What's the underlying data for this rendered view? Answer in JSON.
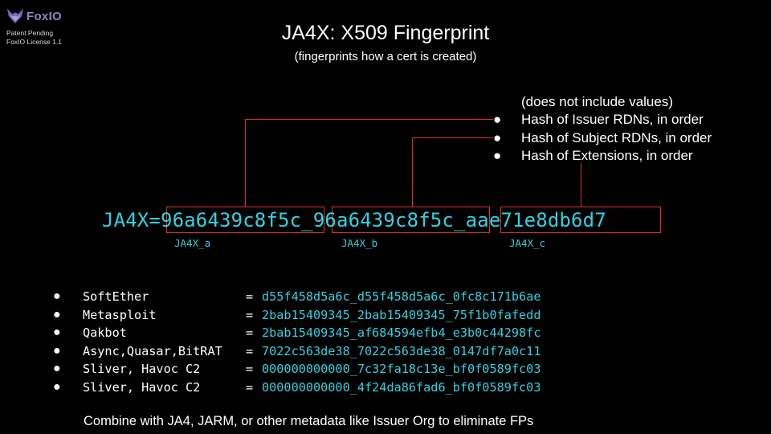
{
  "logo": {
    "text": "FoxIO",
    "brand_color": "#8e86c2"
  },
  "patent": {
    "line1": "Patent Pending",
    "line2": "FoxIO License 1.1"
  },
  "title": "JA4X: X509 Fingerprint",
  "subtitle": "(fingerprints how a cert is created)",
  "description": {
    "note": "(does not include values)",
    "items": [
      "Hash of Issuer RDNs, in order",
      "Hash of Subject RDNs, in order",
      "Hash of Extensions, in order"
    ]
  },
  "fingerprint": {
    "prefix": "JA4X=",
    "part_a": "96a6439c8f5c",
    "sep1": "_",
    "part_b": "96a6439c8f5c",
    "sep2": "_",
    "part_c": "aae71e8db6d7",
    "label_a": "JA4X_a",
    "label_b": "JA4X_b",
    "label_c": "JA4X_c"
  },
  "examples": [
    {
      "name": "SoftEther",
      "value": "d55f458d5a6c_d55f458d5a6c_0fc8c171b6ae"
    },
    {
      "name": "Metasploit",
      "value": "2bab15409345_2bab15409345_75f1b0fafedd"
    },
    {
      "name": "Qakbot",
      "value": "2bab15409345_af684594efb4_e3b0c44298fc"
    },
    {
      "name": "Async,Quasar,BitRAT",
      "value": "7022c563de38_7022c563de38_0147df7a0c11"
    },
    {
      "name": "Sliver, Havoc C2",
      "value": "000000000000_7c32fa18c13e_bf0f0589fc03"
    },
    {
      "name": "Sliver, Havoc C2",
      "value": "000000000000_4f24da86fad6_bf0f0589fc03"
    }
  ],
  "example_bullet": "●",
  "example_eq": "=",
  "footer": "Combine with JA4, JARM, or other metadata like Issuer Org to eliminate FPs",
  "colors": {
    "background": "#000000",
    "text": "#ffffff",
    "accent_cyan": "#35d0e0",
    "connector_red": "#e03030"
  },
  "icons": {
    "logo": "fox-head-icon",
    "bullet": "bullet-icon"
  }
}
